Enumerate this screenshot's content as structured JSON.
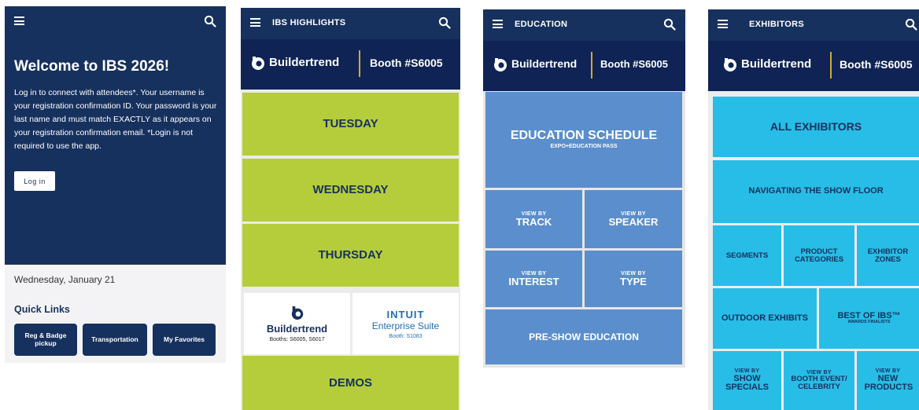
{
  "screens": [
    {
      "id": "home",
      "welcome_title": "Welcome to IBS 2026!",
      "intro_text": "Log in to connect with attendees*. Your username is your registration confirmation ID. Your password is your last name and must match EXACTLY as it appears on your registration confirmation email.  *Login is not required to use the app.",
      "login_label": "Log in",
      "date": "Wednesday, January 21",
      "quick_links_title": "Quick Links",
      "quick_links": [
        "Reg & Badge pickup",
        "Transportation",
        "My Favorites"
      ]
    },
    {
      "id": "ibs-highlights",
      "title": "IBS HIGHLIGHTS",
      "tiles": [
        "TUESDAY",
        "WEDNESDAY",
        "THURSDAY",
        "DEMOS"
      ],
      "buildertrend_booths": "Booths: S6005, S6017",
      "intuit_name": "INTUIT",
      "intuit_product": "Enterprise Suite",
      "intuit_booth": "Booth: S1083"
    },
    {
      "id": "education",
      "title": "EDUCATION",
      "schedule_title": "EDUCATION SCHEDULE",
      "schedule_sub": "EXPO+EDUCATION PASS",
      "view_by_label": "VIEW BY",
      "view_by": [
        "TRACK",
        "SPEAKER",
        "INTEREST",
        "TYPE"
      ],
      "pre_show": "PRE-SHOW EDUCATION"
    },
    {
      "id": "exhibitors",
      "title": "EXHIBITORS",
      "all_exhibitors": "ALL EXHIBITORS",
      "navigating": "NAVIGATING THE SHOW FLOOR",
      "segments": "SEGMENTS",
      "product_categories": "PRODUCT CATEGORIES",
      "exhibitor_zones": "EXHIBITOR ZONES",
      "outdoor_exhibits": "OUTDOOR EXHIBITS",
      "best_of_ibs": "BEST OF IBS™",
      "best_of_sub": "AWARDS FINALISTS",
      "view_by_label": "VIEW BY",
      "show_specials": "SHOW SPECIALS",
      "booth_event": "BOOTH EVENT/ CELEBRITY",
      "new_products": "NEW PRODUCTS"
    }
  ],
  "banner": {
    "brand": "Buildertrend",
    "booth": "Booth #S6005"
  },
  "icons": [
    "hamburger-icon",
    "search-icon",
    "buildertrend-logo-icon"
  ],
  "colors": {
    "navy": "#17315e",
    "banner_navy": "#0f2455",
    "lime": "#b5cd3a",
    "education_blue": "#5b8ecc",
    "exhibitor_cyan": "#27bde6",
    "gold_divider": "#d8a437"
  }
}
